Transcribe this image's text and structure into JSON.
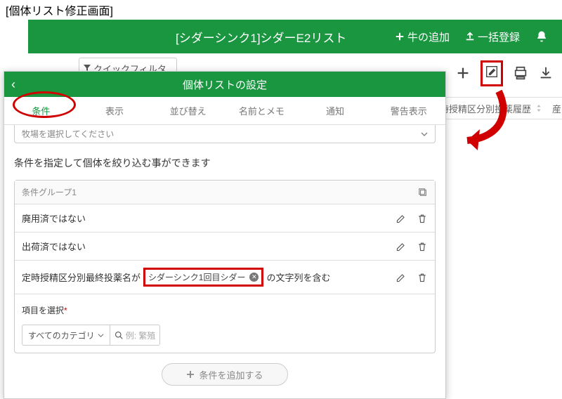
{
  "page_label": "[個体リスト修正画面]",
  "main": {
    "title": "[シダーシンク1]シダーE2リスト",
    "add_cow": "牛の追加",
    "bulk": "一括登録",
    "quick_filter": "クイックフィルタ"
  },
  "table": {
    "col": "時授精区分別投薬履歴",
    "col2": "産"
  },
  "panel": {
    "title": "個体リストの設定",
    "tabs": [
      "条件",
      "表示",
      "並び替え",
      "名前とメモ",
      "通知",
      "警告表示"
    ],
    "select_placeholder": "牧場を選択してください",
    "desc": "条件を指定して個体を絞り込む事ができます",
    "group_title": "条件グループ1",
    "rows": {
      "r1": "廃用済ではない",
      "r2": "出荷済ではない",
      "r3_pre": "定時授精区分別最終投薬名が",
      "r3_chip": "シダーシンク1回目シダー",
      "r3_post": "の文字列を含む"
    },
    "select_label": "項目を選択",
    "cat_label": "すべてのカテゴリ",
    "search_ph": "例: 繁殖",
    "add_cond": "条件を追加する"
  }
}
